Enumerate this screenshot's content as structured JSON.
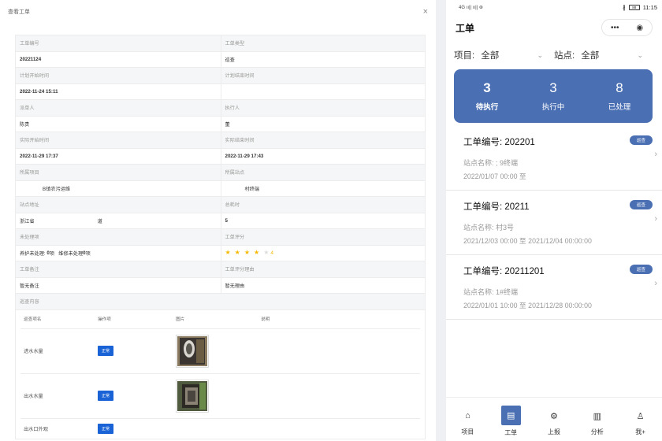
{
  "left": {
    "title": "查看工单",
    "close_glyph": "×",
    "fields": {
      "order_no_label": "工单编号",
      "order_no": "20221124",
      "type_label": "工单类型",
      "type": "巡查",
      "plan_start_label": "计划开始时间",
      "plan_start": "2022-11-24 15:11",
      "plan_end_label": "计划结束时间",
      "plan_end": "",
      "issuer_label": "派单人",
      "issuer": "陈贵",
      "executor_label": "执行人",
      "executor": "董",
      "actual_start_label": "实际开始时间",
      "actual_start": "2022-11-29 17:37",
      "actual_end_label": "实际结束时间",
      "actual_end": "2022-11-29 17:43",
      "project_label": "所属项目",
      "project": "B镇农污运维",
      "site_label": "所属站点",
      "site": "村终端",
      "address_label": "站点地址",
      "address_province": "浙江省",
      "address_rest": "道",
      "duration_label": "总耗时",
      "duration": "5",
      "unhandled_label": "未处理项",
      "maint_label": "养护未处理:",
      "maint_count": "0",
      "maint_unit": "项",
      "repair_label": "维修未处理",
      "repair_count": "0",
      "repair_unit": "项",
      "rating_label": "工单评分",
      "rating": 4,
      "rating_text": "4",
      "remark_label": "工单备注",
      "remark": "暂无备注",
      "rating_reason_label": "工单评分理由",
      "rating_reason": "暂无理由",
      "inspection_label": "巡查内容"
    },
    "inspection": {
      "headers": [
        "巡查项名",
        "操作项",
        "图片",
        "说明"
      ],
      "rows": [
        {
          "name": "进水水量",
          "status": "正常",
          "note": ""
        },
        {
          "name": "出水水量",
          "status": "正常",
          "note": ""
        },
        {
          "name": "出水口外观",
          "status": "正常",
          "note": ""
        }
      ]
    }
  },
  "phone": {
    "status_left": "4G ıı|| ıı|| ⊛",
    "status_bt": "∦",
    "battery": "88",
    "time": "11:15",
    "title": "工单",
    "capsule_more": "•••",
    "capsule_close": "◉",
    "project_label": "项目:",
    "project_value": "全部",
    "site_label": "站点:",
    "site_value": "全部",
    "chevron": "⌄",
    "stats": [
      {
        "count": "3",
        "label": "待执行"
      },
      {
        "count": "3",
        "label": "执行中"
      },
      {
        "count": "8",
        "label": "已处理"
      }
    ],
    "cards": [
      {
        "no": "工单编号:  202201",
        "badge": "巡查",
        "site": "站点名称:  ;                  9终端",
        "time": "2022/01/07 00:00 至"
      },
      {
        "no": "工单编号:  20211",
        "badge": "巡查",
        "site": "站点名称:                    村3号",
        "time": "2021/12/03 00:00 至 2021/12/04 00:00:00"
      },
      {
        "no": "工单编号:  20211201",
        "badge": "巡查",
        "site": "站点名称:              1#终端",
        "time": "2022/01/01 10:00 至 2021/12/28 00:00:00"
      }
    ],
    "arrow": "›",
    "tabs": [
      {
        "label": "项目",
        "icon": "⌂"
      },
      {
        "label": "工单",
        "icon": "▤"
      },
      {
        "label": "上报",
        "icon": "⚙"
      },
      {
        "label": "分析",
        "icon": "▥"
      },
      {
        "label": "我+",
        "icon": "♙"
      }
    ]
  }
}
